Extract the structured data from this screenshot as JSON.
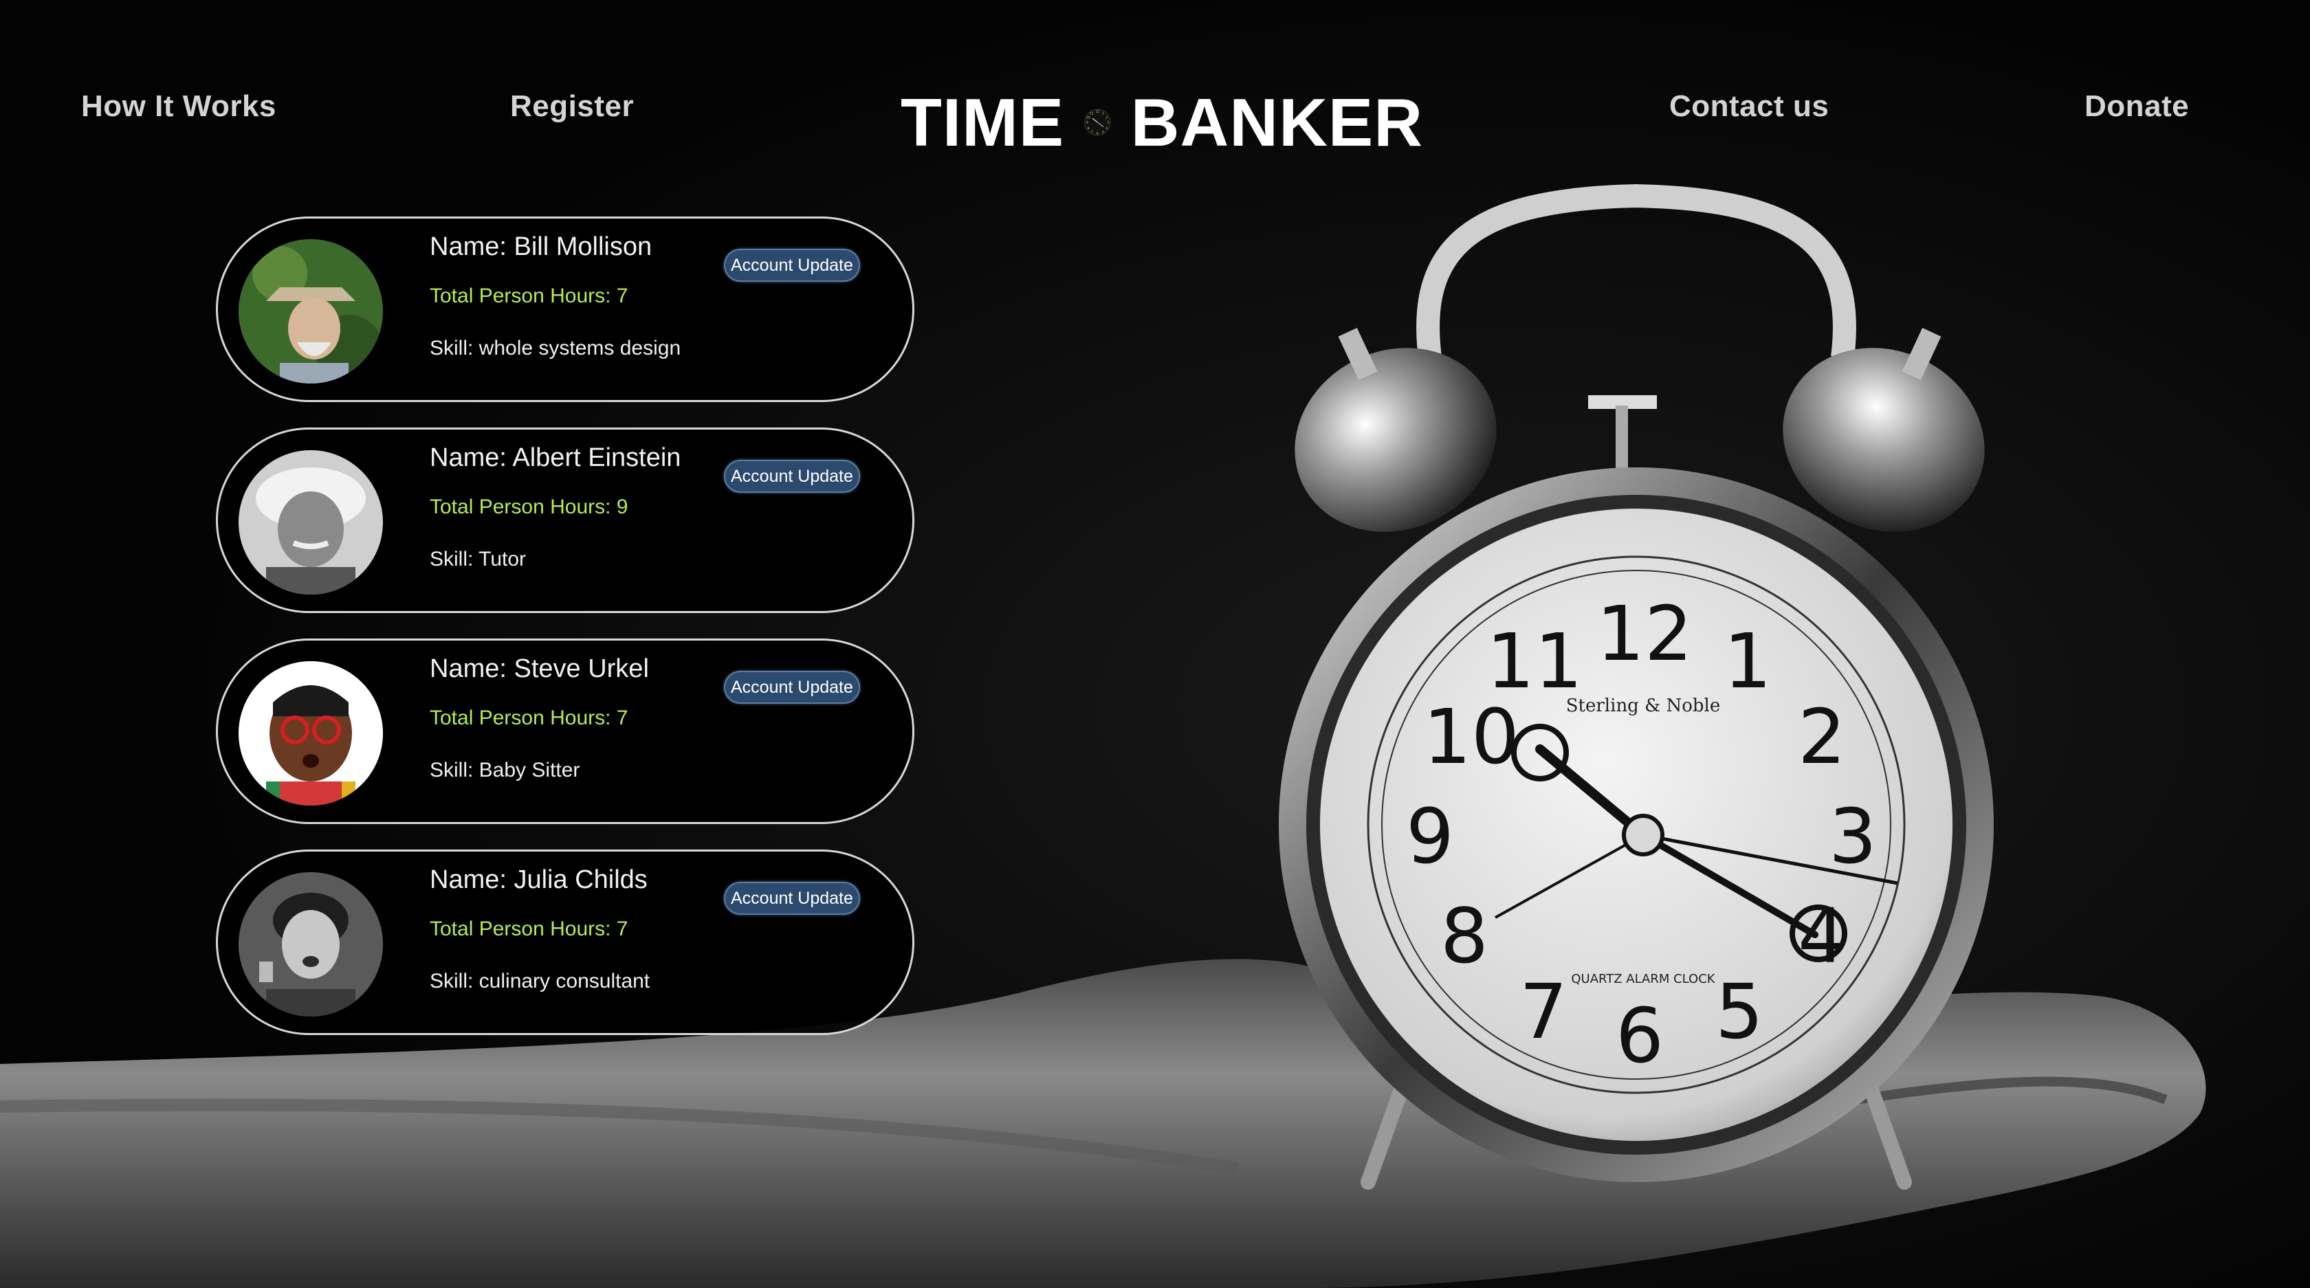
{
  "nav": {
    "how_it_works": "How It Works",
    "register": "Register",
    "contact": "Contact us",
    "donate": "Donate"
  },
  "logo": {
    "word_left": "TIME",
    "word_right": "BANKER",
    "icon": "clock-icon"
  },
  "profiles": [
    {
      "name": "Name: Bill Mollison",
      "hours": "Total Person Hours: 7",
      "skill": "Skill: whole systems design",
      "button": "Account Update"
    },
    {
      "name": "Name: Albert Einstein",
      "hours": "Total Person Hours: 9",
      "skill": "Skill: Tutor",
      "button": "Account Update"
    },
    {
      "name": "Name: Steve Urkel",
      "hours": "Total Person Hours: 7",
      "skill": "Skill: Baby Sitter",
      "button": "Account Update"
    },
    {
      "name": "Name: Julia Childs",
      "hours": "Total Person Hours: 7",
      "skill": "Skill: culinary consultant",
      "button": "Account Update"
    }
  ],
  "background": {
    "dial_brand": "Sterling & Noble",
    "dial_label": "QUARTZ ALARM CLOCK"
  },
  "colors": {
    "hours_text": "#b6ec52",
    "button_bg": "#2c4a6e",
    "card_border": "#d8d8d8"
  }
}
